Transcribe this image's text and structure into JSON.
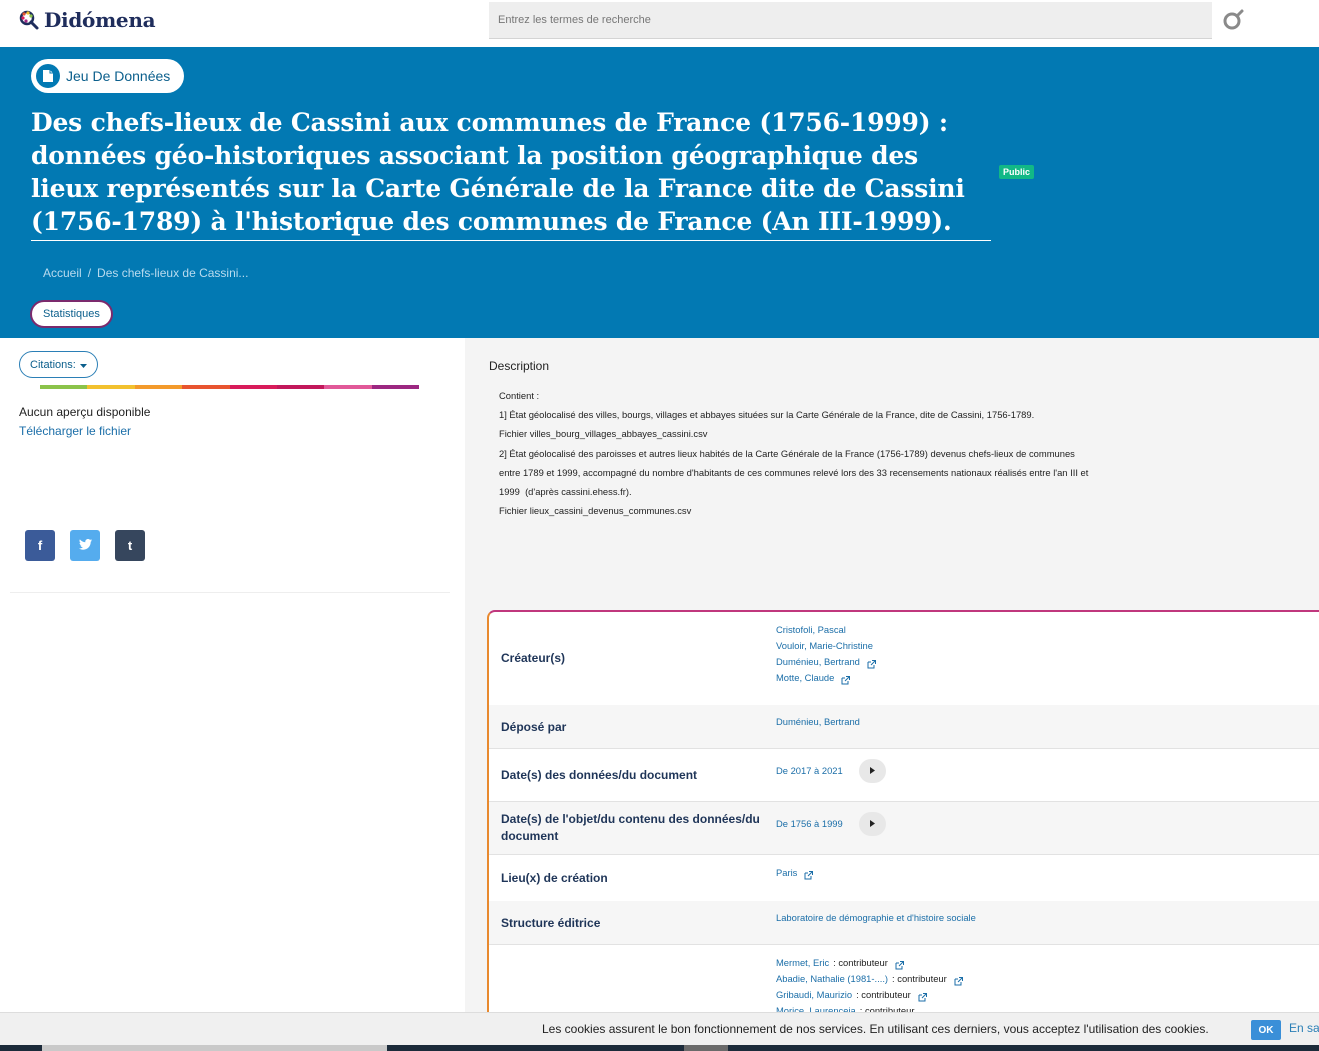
{
  "brand": {
    "name": "Didómena"
  },
  "search": {
    "placeholder": "Entrez les termes de recherche"
  },
  "hero": {
    "type_label": "Jeu De Données",
    "title": "Des chefs-lieux de Cassini aux communes de France (1756-1999) : données géo-historiques associant la position géographique des lieux représentés sur la Carte Générale de la France dite de Cassini (1756-1789) à l'historique des communes de France (An III-1999).",
    "badge": "Public",
    "breadcrumb": {
      "home": "Accueil",
      "separator": "/",
      "current": "Des chefs-lieux de Cassini..."
    },
    "stats_button": "Statistiques"
  },
  "sidebar": {
    "citations_label": "Citations:",
    "no_preview": "Aucun aperçu disponible",
    "download": "Télécharger le fichier",
    "share": {
      "facebook": "f",
      "twitter": "t",
      "tumblr": "t"
    }
  },
  "description": {
    "title": "Description",
    "lines": [
      "Contient :",
      "",
      "1] État géolocalisé des villes, bourgs, villages et abbayes situées sur la Carte Générale de la France, dite de Cassini, 1756-1789.",
      "Fichier villes_bourg_villages_abbayes_cassini.csv",
      "",
      "2] État géolocalisé des paroisses et autres lieux habités de la Carte Générale de la France (1756-1789) devenus chefs-lieux de communes",
      "entre 1789 et 1999, accompagné du nombre d'habitants de ces communes relevé lors des 33 recensements nationaux réalisés entre l'an III et",
      "1999  (d'après cassini.ehess.fr).",
      "Fichier lieux_cassini_devenus_communes.csv"
    ]
  },
  "metadata": {
    "creators": {
      "label": "Créateur(s)",
      "items": [
        {
          "name": "Cristofoli, Pascal",
          "ext": false
        },
        {
          "name": "Vouloir, Marie-Christine",
          "ext": false
        },
        {
          "name": "Duménieu, Bertrand",
          "ext": true
        },
        {
          "name": "Motte, Claude",
          "ext": true
        }
      ]
    },
    "deposited_by": {
      "label": "Déposé par",
      "value": "Duménieu, Bertrand"
    },
    "data_dates": {
      "label": "Date(s) des données/du document",
      "value": "De 2017 à 2021"
    },
    "content_dates": {
      "label": "Date(s) de l'objet/du contenu des données/du document",
      "value": "De 1756 à 1999"
    },
    "place": {
      "label": "Lieu(x) de création",
      "value": "Paris"
    },
    "publisher": {
      "label": "Structure éditrice",
      "value": "Laboratoire de démographie et d'histoire sociale"
    },
    "contributors": {
      "items": [
        {
          "name": "Mermet, Eric",
          "role": " : contributeur"
        },
        {
          "name": "Abadie, Nathalie (1981-....)",
          "role": " : contributeur"
        },
        {
          "name": "Gribaudi, Maurizio",
          "role": " : contributeur"
        },
        {
          "name": "Morice, Laurenceia",
          "role": " : contributeur"
        }
      ]
    }
  },
  "cookie": {
    "text": "Les cookies assurent le bon fonctionnement de nos services. En utilisant ces derniers, vous acceptez l'utilisation des cookies.",
    "ok": "OK",
    "more": "En savoir plus"
  },
  "colors": {
    "header_blue": "#0279b3",
    "public_green": "#12b886",
    "rainbow": [
      "#8bc34a",
      "#f2c12e",
      "#f39a2b",
      "#e8542f",
      "#d81b5a",
      "#c2185b",
      "#e15898",
      "#9c2781"
    ]
  },
  "icons": {
    "logo": "didomena-logo-icon",
    "search": "search-icon",
    "document": "document-icon",
    "external": "external-link-icon",
    "play": "play-icon",
    "caret": "caret-down-icon"
  }
}
